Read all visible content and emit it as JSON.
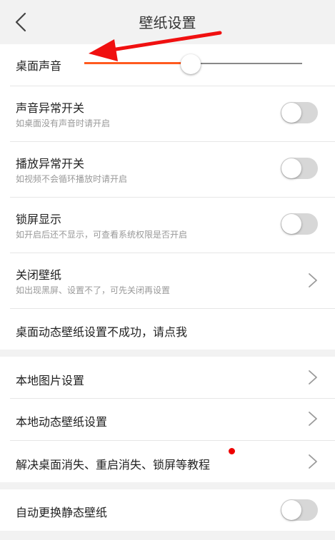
{
  "header": {
    "title": "壁纸设置",
    "back_icon": "chevron-left-icon"
  },
  "sound": {
    "label": "桌面声音",
    "volume_fraction": 0.49,
    "accent_color": "#ff5a1f"
  },
  "settings": [
    {
      "title": "声音异常开关",
      "subtitle": "如桌面没有声音时请开启",
      "control": "toggle",
      "on": false
    },
    {
      "title": "播放异常开关",
      "subtitle": "如视频不会循环播放时请开启",
      "control": "toggle",
      "on": false
    },
    {
      "title": "锁屏显示",
      "subtitle": "如开启后还不显示，可查看系统权限是否开启",
      "control": "toggle",
      "on": false
    },
    {
      "title": "关闭壁纸",
      "subtitle": "如出现黑屏、设置不了，可先关闭再设置",
      "control": "chevron"
    },
    {
      "title": "桌面动态壁纸设置不成功，请点我",
      "control": "none"
    }
  ],
  "local": [
    {
      "title": "本地图片设置",
      "control": "chevron"
    },
    {
      "title": "本地动态壁纸设置",
      "control": "chevron"
    },
    {
      "title": "解决桌面消失、重启消失、锁屏等教程",
      "control": "chevron",
      "badge": "red-dot"
    }
  ],
  "auto": {
    "title": "自动更换静态壁纸",
    "on": false
  },
  "annotation": {
    "arrow_color": "#f01010",
    "icon": "red-arrow-annotation"
  }
}
